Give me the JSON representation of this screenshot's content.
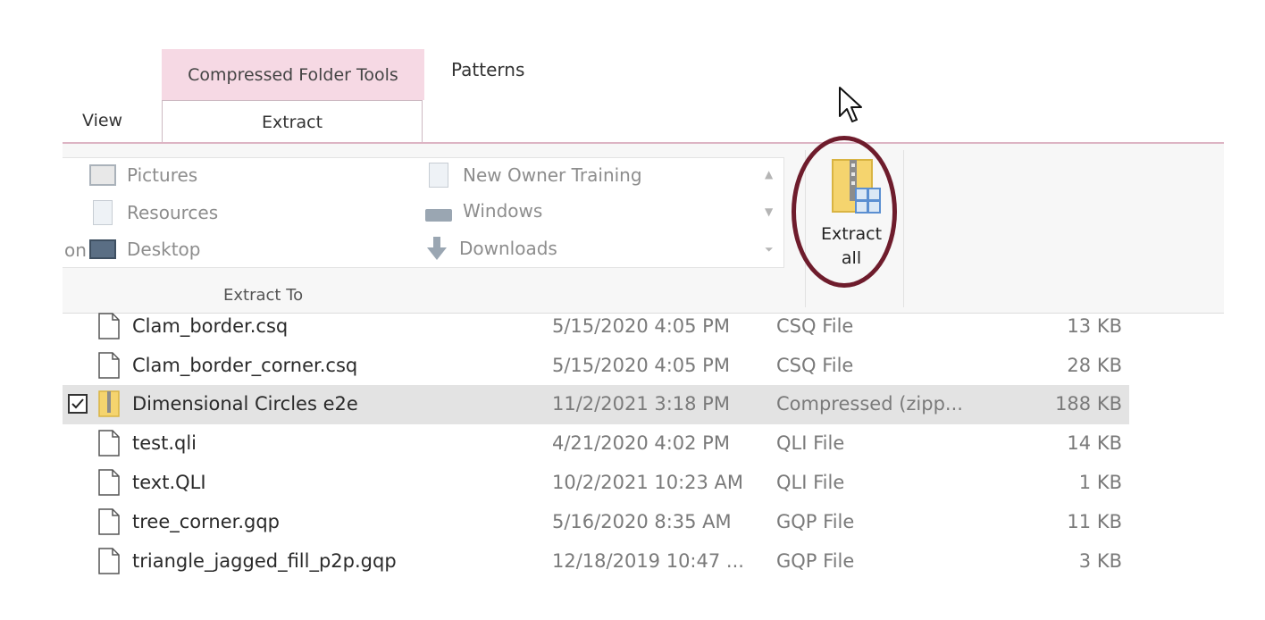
{
  "ribbon": {
    "context_header": "Compressed Folder Tools",
    "tabs": {
      "patterns": "Patterns",
      "view": "View",
      "extract": "Extract"
    },
    "gallery": [
      {
        "label": "Pictures",
        "icon": "pictures-folder-icon"
      },
      {
        "label": "Resources",
        "icon": "folder-icon"
      },
      {
        "label": "Desktop",
        "icon": "desktop-icon"
      },
      {
        "label": "New Owner Training",
        "icon": "folder-icon"
      },
      {
        "label": "Windows",
        "icon": "drive-icon"
      },
      {
        "label": "Downloads",
        "icon": "download-arrow-icon"
      }
    ],
    "truncated_left": "on",
    "group_label": "Extract To",
    "extract_all": {
      "line1": "Extract",
      "line2": "all",
      "icon": "zip-extract-icon"
    }
  },
  "files": [
    {
      "name": "Clam_border.csq",
      "date": "5/15/2020 4:05 PM",
      "type": "CSQ File",
      "size": "13 KB",
      "selected": false
    },
    {
      "name": "Clam_border_corner.csq",
      "date": "5/15/2020 4:05 PM",
      "type": "CSQ File",
      "size": "28 KB",
      "selected": false
    },
    {
      "name": "Dimensional Circles e2e",
      "date": "11/2/2021 3:18 PM",
      "type": "Compressed (zipp...",
      "size": "188 KB",
      "selected": true
    },
    {
      "name": "test.qli",
      "date": "4/21/2020 4:02 PM",
      "type": "QLI File",
      "size": "14 KB",
      "selected": false
    },
    {
      "name": "text.QLI",
      "date": "10/2/2021 10:23 AM",
      "type": "QLI File",
      "size": "1 KB",
      "selected": false
    },
    {
      "name": "tree_corner.gqp",
      "date": "5/16/2020 8:35 AM",
      "type": "GQP File",
      "size": "11 KB",
      "selected": false
    },
    {
      "name": "triangle_jagged_fill_p2p.gqp",
      "date": "12/18/2019 10:47 ...",
      "type": "GQP File",
      "size": "3 KB",
      "selected": false
    }
  ],
  "colors": {
    "context_tab": "#f6d9e4",
    "highlight_ring": "#6e1c2c",
    "selected_row": "#e3e3e3"
  }
}
